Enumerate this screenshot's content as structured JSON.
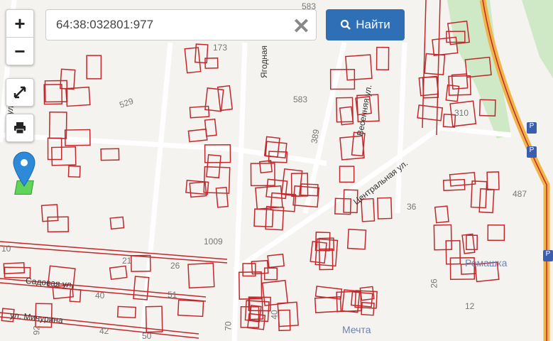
{
  "search": {
    "value": "64:38:032801:977",
    "clear_icon": "close-icon",
    "button_label": "Найти",
    "button_icon": "search-icon"
  },
  "controls": {
    "zoom_in": "+",
    "zoom_out": "−",
    "fullscreen_icon": "expand-icon",
    "print_icon": "printer-icon"
  },
  "marker": {
    "icon": "map-pin-icon",
    "color": "#2e8ad8"
  },
  "streets": [
    "Ягодная",
    "Весенняя ул.",
    "Центральная ул.",
    "Садовая ул.",
    "ул. Мичурина",
    "ул."
  ],
  "places": [
    "Ромашка",
    "Мечта"
  ],
  "numbers": [
    "173",
    "583",
    "529",
    "389",
    "310",
    "487",
    "36",
    "1009",
    "10",
    "21",
    "26",
    "40",
    "51",
    "42",
    "50",
    "92",
    "70",
    "40",
    "26",
    "12",
    "583"
  ],
  "road_shield": "Р",
  "colors": {
    "parcel": "#c0282c",
    "road": "#f0b44a",
    "green": "#c9e8c0",
    "button": "#2e6fb5"
  }
}
